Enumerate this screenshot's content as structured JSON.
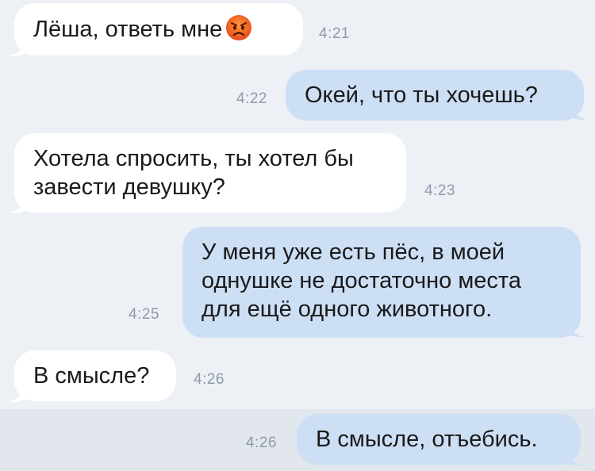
{
  "messages": [
    {
      "direction": "in",
      "text": "Лёша, ответь мне",
      "emoji": "angry-face-emoji",
      "time": "4:21"
    },
    {
      "direction": "out",
      "text": "Окей, что ты хочешь?",
      "time": "4:22"
    },
    {
      "direction": "in",
      "lines": [
        "Хотела спросить, ты хотел бы",
        "завести девушку?"
      ],
      "time": "4:23"
    },
    {
      "direction": "out",
      "lines": [
        "У меня уже есть пёс, в моей",
        "однушке не достаточно места",
        "для ещё одного животного."
      ],
      "time": "4:25"
    },
    {
      "direction": "in",
      "text": "В смысле?",
      "time": "4:26"
    },
    {
      "direction": "out",
      "text": "В смысле, отъебись.",
      "time": "4:26"
    }
  ],
  "colors": {
    "background": "#edf1f6",
    "incoming_bubble": "#ffffff",
    "outgoing_bubble": "#cddff5",
    "timestamp": "#8e9aa8",
    "highlight_row": "#e2e7ee"
  }
}
